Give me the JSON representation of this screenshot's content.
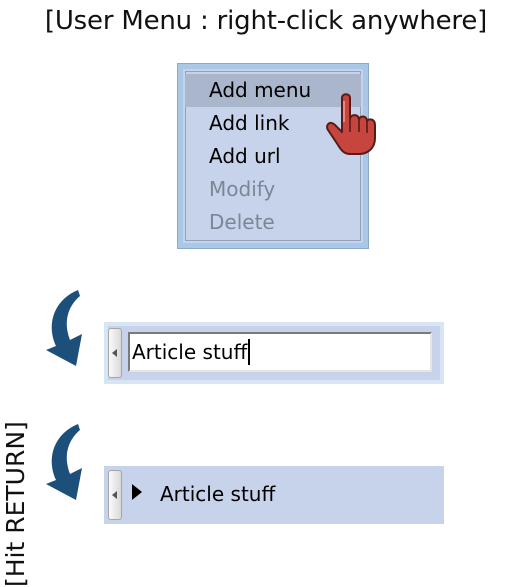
{
  "caption": {
    "top": "[User Menu : right-click anywhere]",
    "side": "[Hit RETURN]"
  },
  "context_menu": {
    "items": [
      {
        "label": "Add menu",
        "state": "highlighted"
      },
      {
        "label": "Add link",
        "state": "enabled"
      },
      {
        "label": "Add url",
        "state": "enabled"
      },
      {
        "label": "Modify",
        "state": "disabled"
      },
      {
        "label": "Delete",
        "state": "disabled"
      }
    ]
  },
  "edit_row": {
    "input_value": "Article stuff"
  },
  "result_row": {
    "label": "Article stuff"
  },
  "icons": {
    "pointer": "hand-pointer-icon",
    "arrow": "curved-down-arrow-icon",
    "expand": "expand-triangle-icon",
    "handle": "scroll-left-arrow-icon"
  },
  "colors": {
    "menu_bg": "#c6d3ea",
    "menu_highlight": "#aab6cb",
    "disabled_text": "#7d8696",
    "arrow": "#1d4f7b",
    "hand": "#c6453f"
  }
}
